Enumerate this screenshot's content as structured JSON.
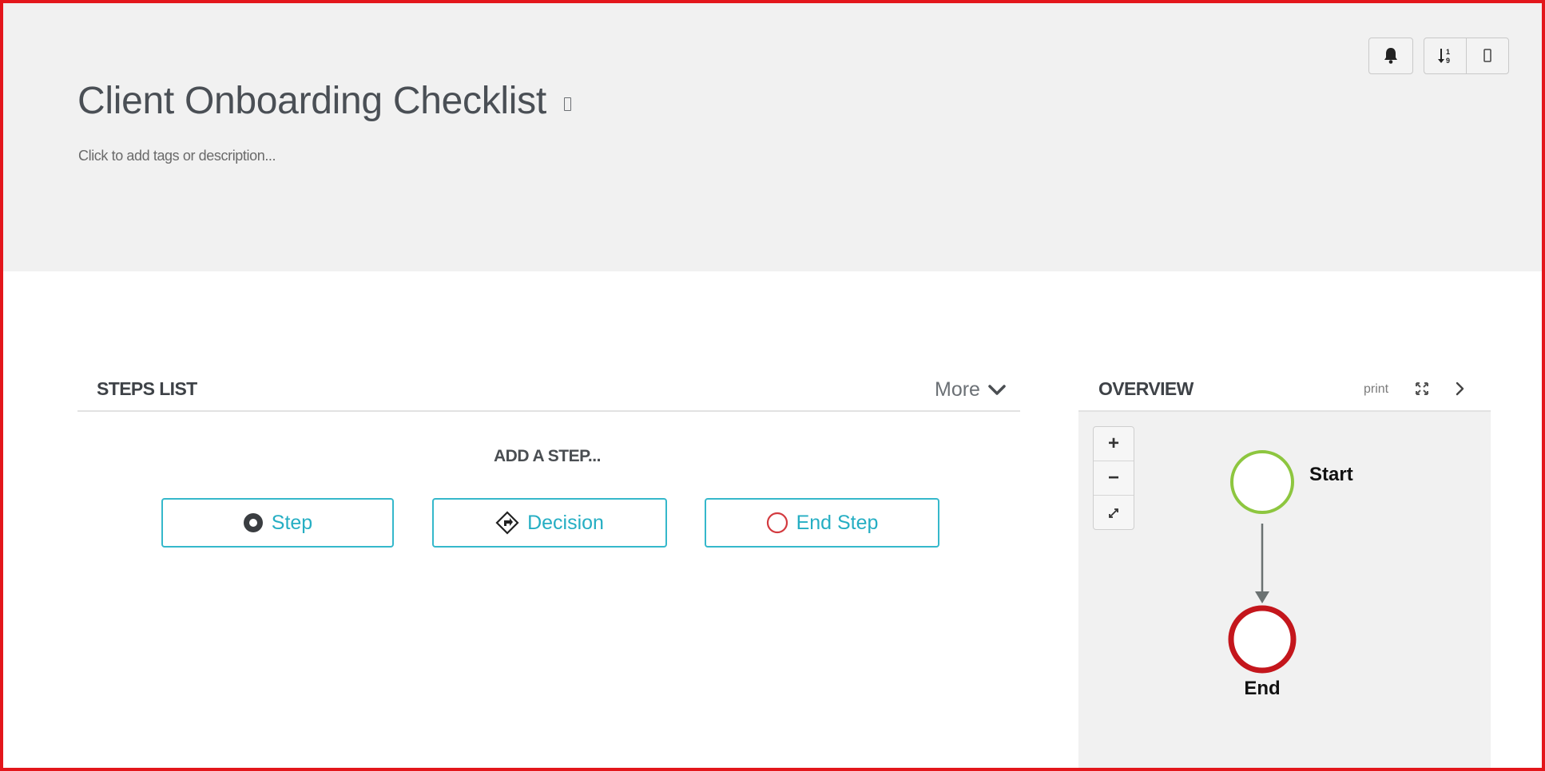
{
  "header": {
    "title": "Client Onboarding Checklist",
    "subtitle": "Click to add tags or description...",
    "buttons": {
      "notifications_icon": "bell-icon",
      "sort_icon": "sort-icon",
      "calendar_icon": "calendar-icon"
    }
  },
  "steps_list": {
    "title": "STEPS LIST",
    "more_label": "More",
    "add_step_label": "ADD A STEP...",
    "buttons": {
      "step": "Step",
      "decision": "Decision",
      "end_step": "End Step"
    }
  },
  "overview": {
    "title": "OVERVIEW",
    "print_label": "print",
    "zoom_in": "+",
    "zoom_out": "−",
    "start_label": "Start",
    "end_label": "End"
  },
  "colors": {
    "accent": "#35b8cb",
    "frame_border": "#e3161b",
    "start_node": "#8dc63f",
    "end_node": "#c4161c"
  }
}
